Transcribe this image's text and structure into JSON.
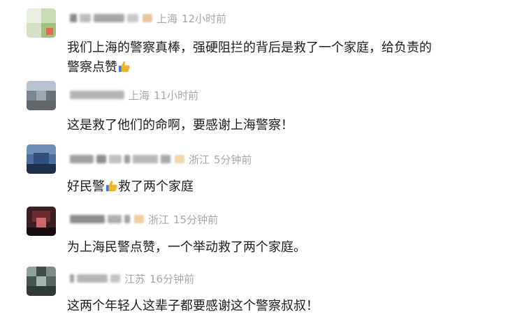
{
  "comments": [
    {
      "location": "上海",
      "time": "12小时前",
      "text_before": "我们上海的警察真棒，强硬阻拦的背后是救了一个家庭，给负责的",
      "text_line2": "警察点赞"
    },
    {
      "location": "上海",
      "time": "11小时前",
      "text": "这是救了他们的命啊，要感谢上海警察！"
    },
    {
      "location": "浙江",
      "time": "5分钟前",
      "text_before": "好民警",
      "text_after": "救了两个家庭"
    },
    {
      "location": "浙江",
      "time": "15分钟前",
      "text": "为上海民警点赞，一个举动救了两个家庭。"
    },
    {
      "location": "江苏",
      "time": "16分钟前",
      "text": "这两个年轻人这辈子都要感谢这个警察叔叔！"
    }
  ],
  "icons": {
    "thumbs_up": "thumbs-up-emoji"
  },
  "colors": {
    "text": "#1c1c1c",
    "meta": "#a7a7a7",
    "thumb": "#f2b12b"
  }
}
